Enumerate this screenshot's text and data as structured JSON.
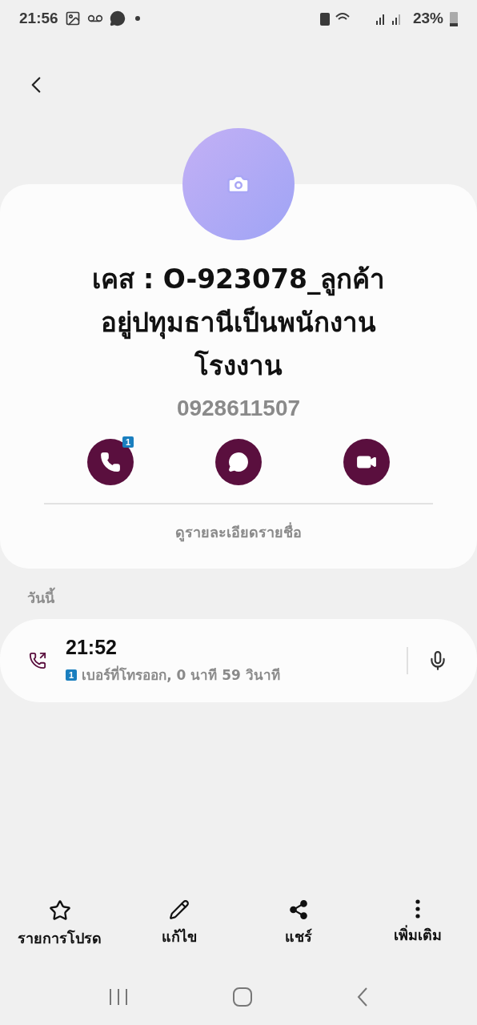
{
  "status_bar": {
    "time": "21:56",
    "battery": "23%"
  },
  "contact": {
    "name_lines": [
      "เคส : O-923078_ลูกค้า",
      "อยู่ปทุมธานีเป็นพนักงาน",
      "โรงงาน"
    ],
    "phone": "0928611507"
  },
  "actions": [
    {
      "kind": "call",
      "badge": "1"
    },
    {
      "kind": "message"
    },
    {
      "kind": "video"
    }
  ],
  "details_link": "ดูรายละเอียดรายชื่อ",
  "history": {
    "heading": "วันนี้",
    "entries": [
      {
        "kind": "outgoing",
        "time": "21:52",
        "sim": "1",
        "description": "เบอร์ที่โทรออก, 0 นาที 59 วินาที"
      }
    ]
  },
  "bottom_bar": [
    {
      "kind": "favorite",
      "label": "รายการโปรด"
    },
    {
      "kind": "edit",
      "label": "แก้ไข"
    },
    {
      "kind": "share",
      "label": "แชร์"
    },
    {
      "kind": "more",
      "label": "เพิ่มเติม"
    }
  ]
}
